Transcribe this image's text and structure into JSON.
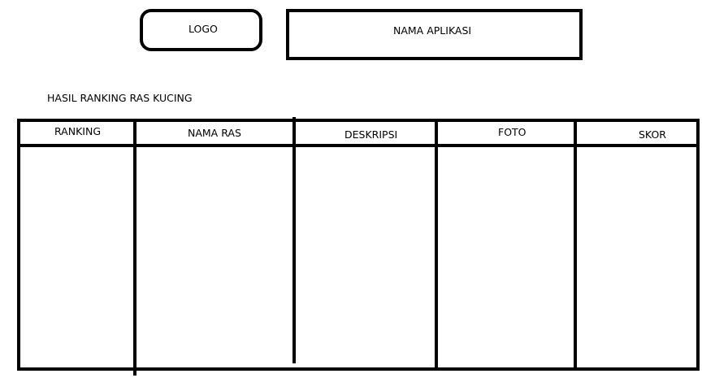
{
  "header": {
    "logo_label": "LOGO",
    "app_name": "NAMA APLIKASI"
  },
  "section": {
    "title": "HASIL RANKING RAS KUCING"
  },
  "table": {
    "columns": [
      "RANKING",
      "NAMA RAS",
      "DESKRIPSI",
      "FOTO",
      "SKOR"
    ],
    "rows": []
  }
}
